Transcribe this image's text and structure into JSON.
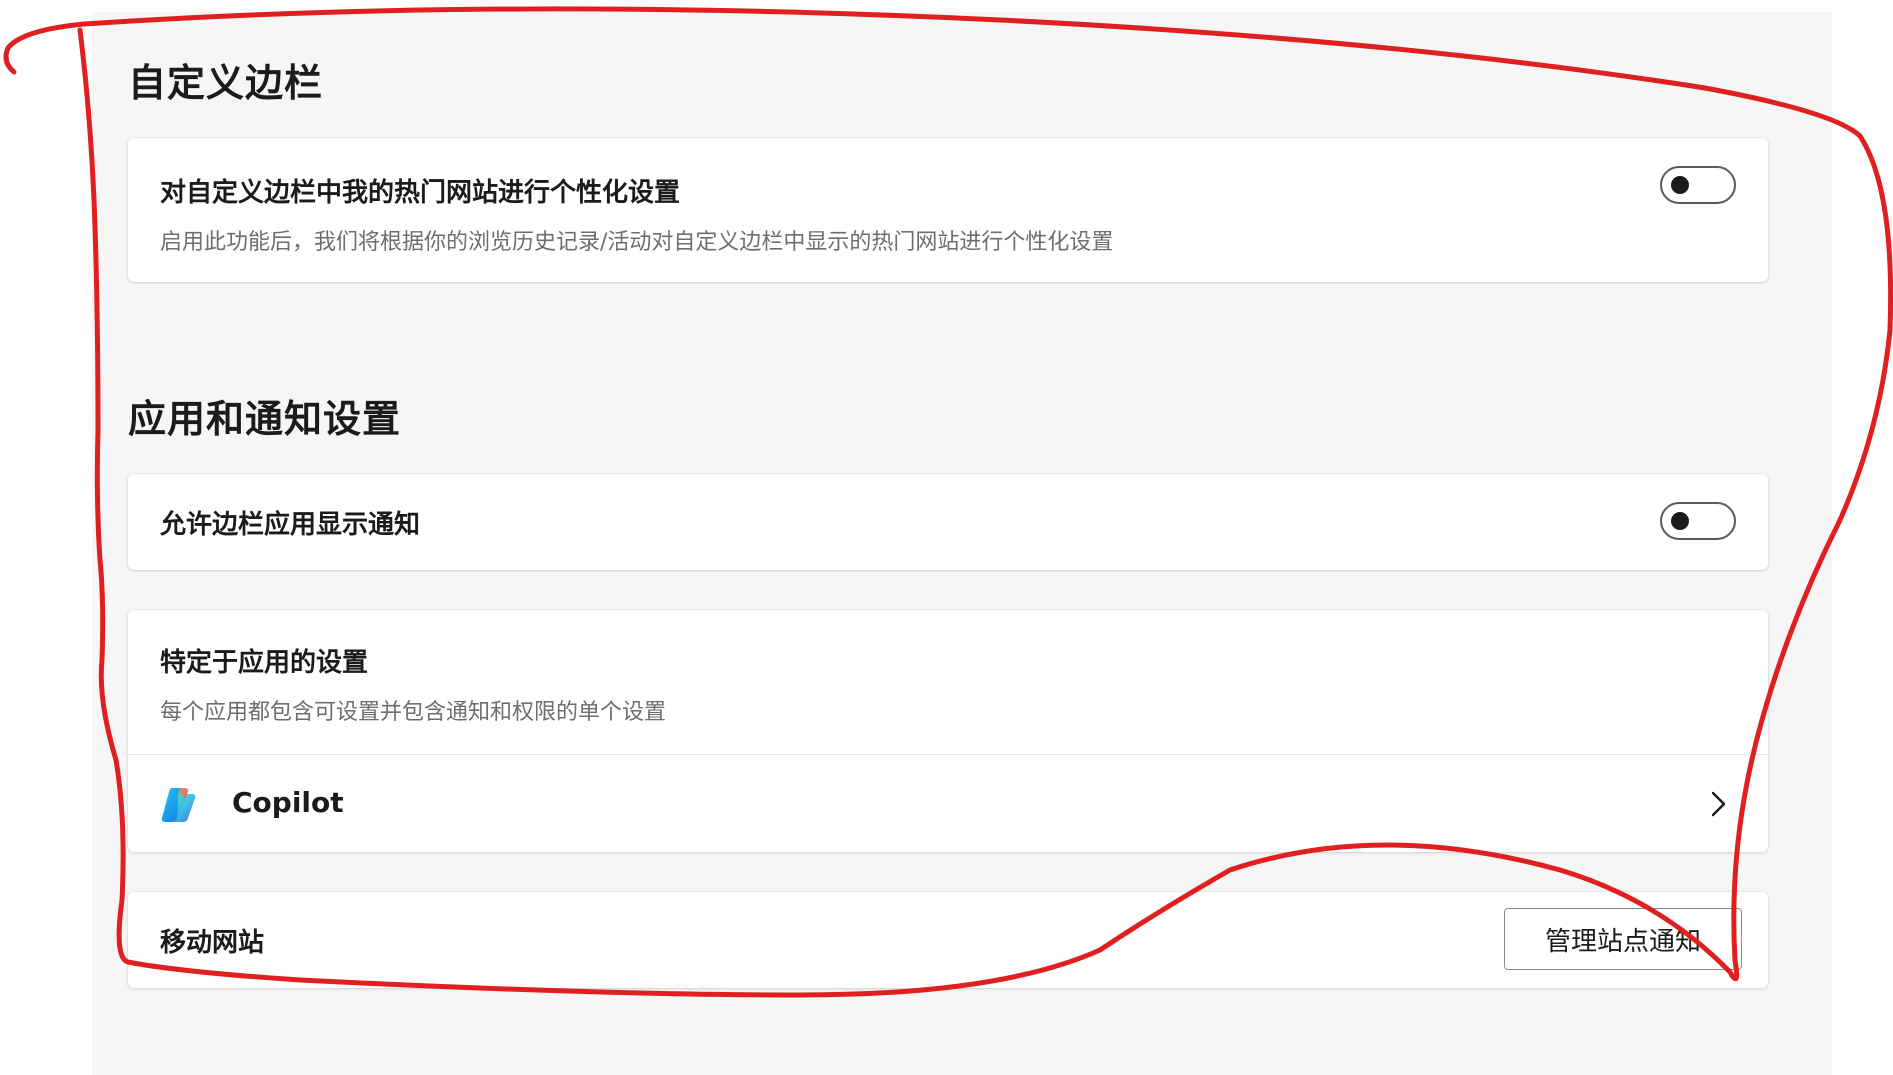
{
  "sidebar_section": {
    "title": "自定义边栏",
    "personalize": {
      "title": "对自定义边栏中我的热门网站进行个性化设置",
      "description": "启用此功能后，我们将根据你的浏览历史记录/活动对自定义边栏中显示的热门网站进行个性化设置",
      "enabled": false
    }
  },
  "apps_section": {
    "title": "应用和通知设置",
    "allow_notifications": {
      "title": "允许边栏应用显示通知",
      "enabled": false
    },
    "app_specific": {
      "title": "特定于应用的设置",
      "description": "每个应用都包含可设置并包含通知和权限的单个设置",
      "apps": [
        {
          "name": "Copilot",
          "icon": "copilot-icon"
        }
      ]
    },
    "mobile_sites": {
      "title": "移动网站",
      "button_label": "管理站点通知"
    }
  },
  "colors": {
    "panel_background": "#f6f6f6",
    "card_background": "#ffffff",
    "annotation_stroke": "#e02020"
  }
}
